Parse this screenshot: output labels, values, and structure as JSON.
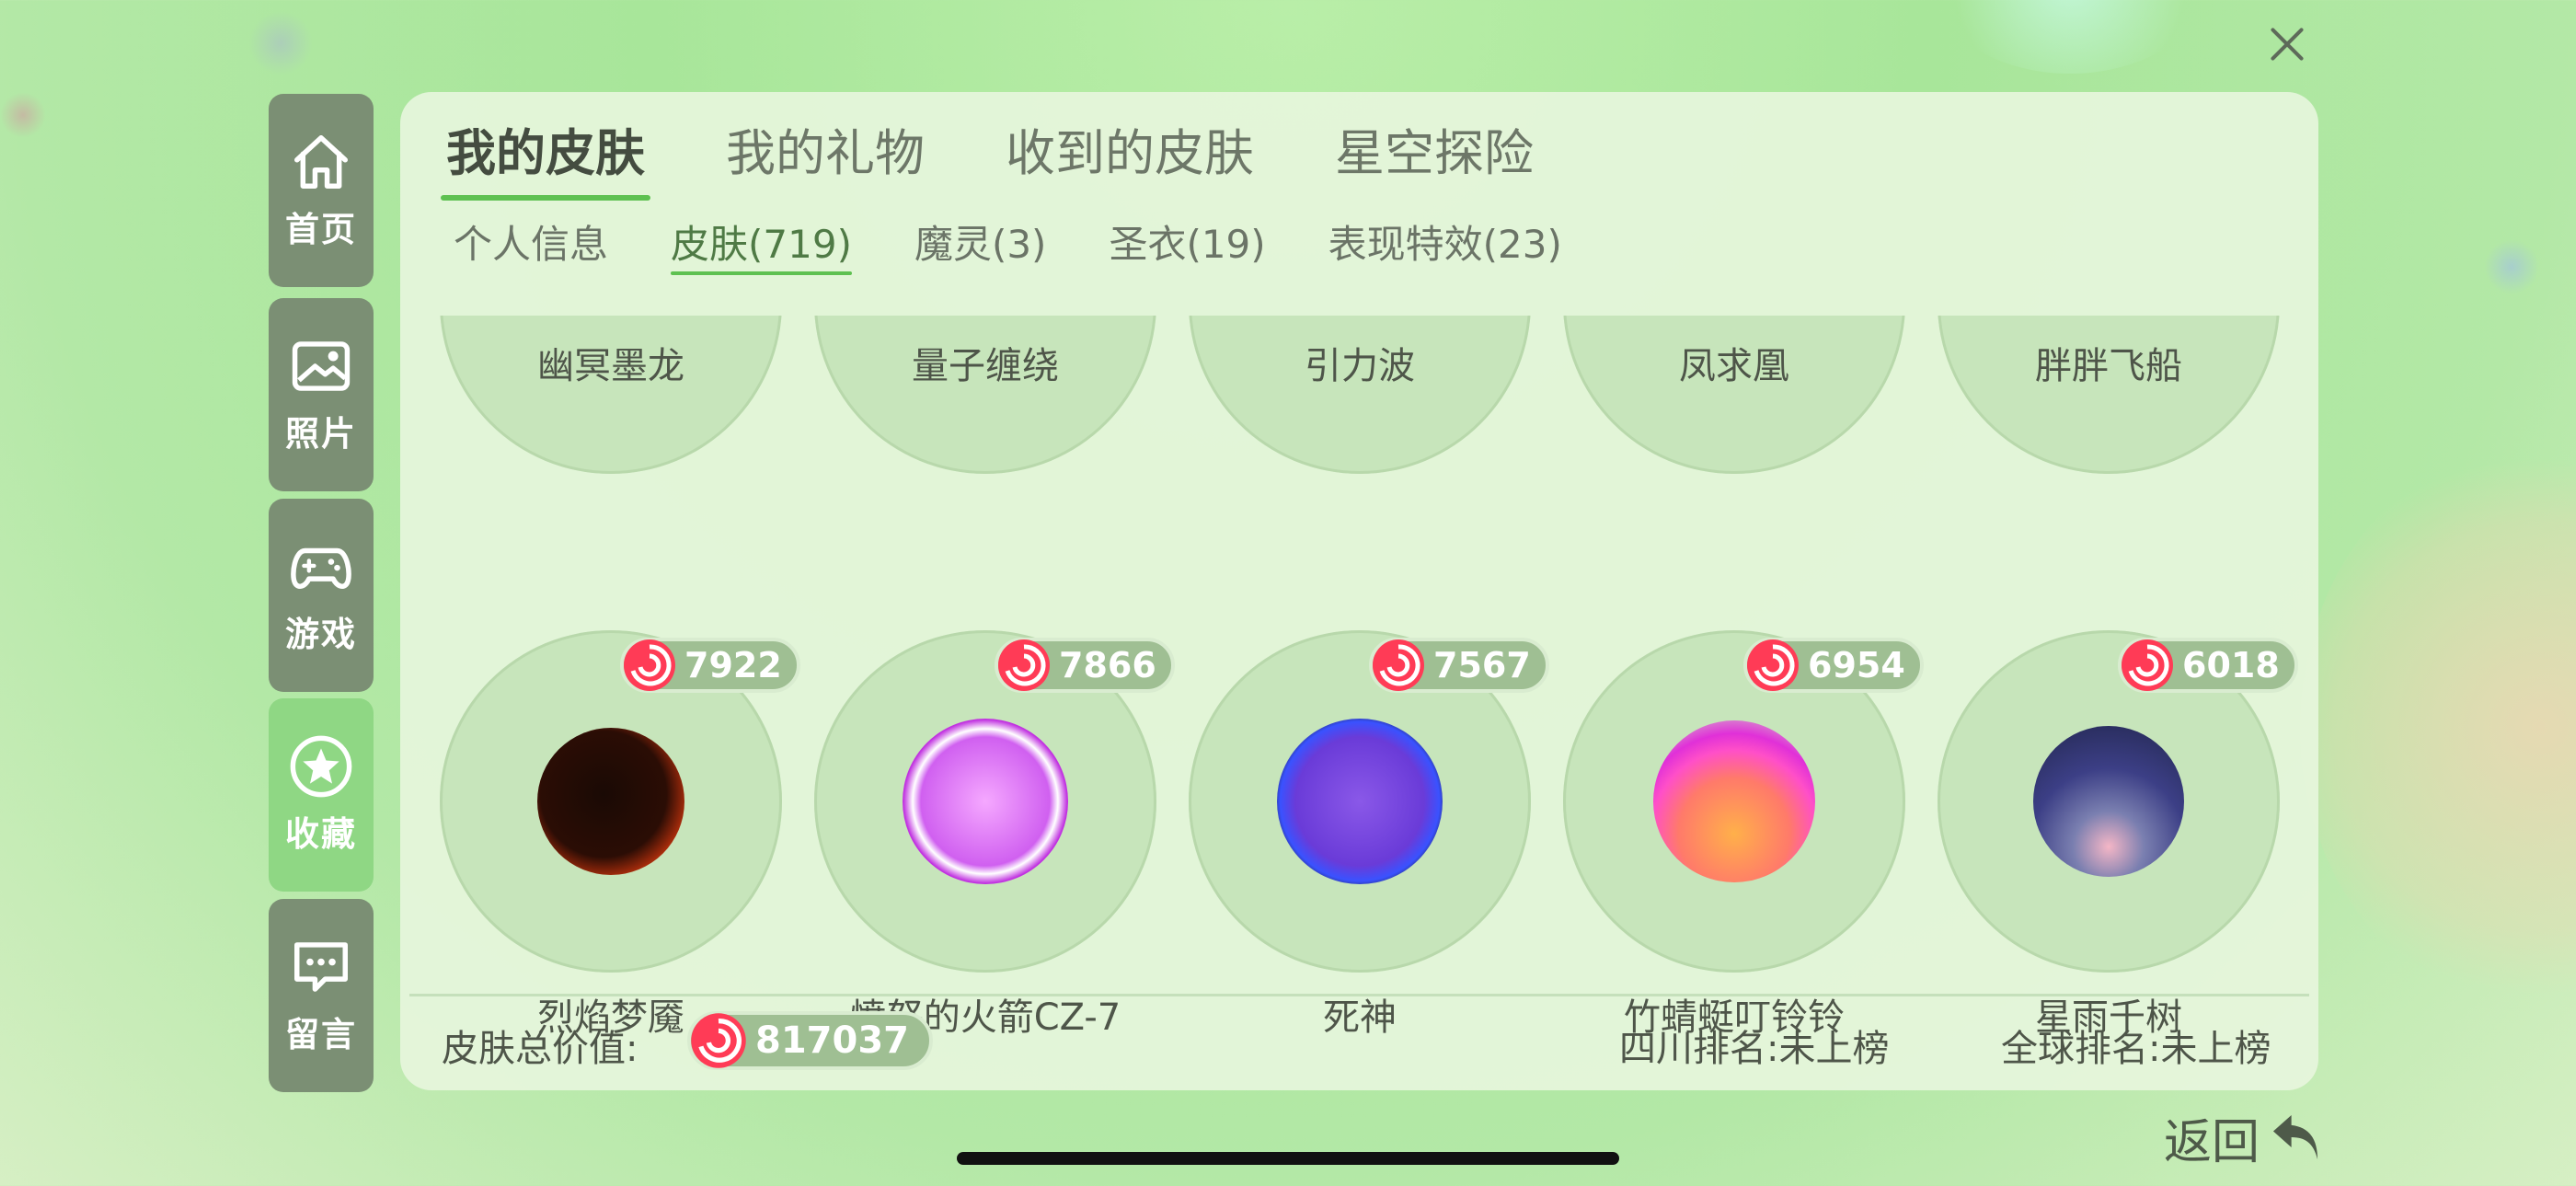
{
  "sidebar": {
    "items": [
      {
        "label": "首页",
        "icon": "home-icon",
        "active": false
      },
      {
        "label": "照片",
        "icon": "photo-icon",
        "active": false
      },
      {
        "label": "游戏",
        "icon": "gamepad-icon",
        "active": false
      },
      {
        "label": "收藏",
        "icon": "star-icon",
        "active": true
      },
      {
        "label": "留言",
        "icon": "message-icon",
        "active": false
      }
    ]
  },
  "tabs": [
    "我的皮肤",
    "我的礼物",
    "收到的皮肤",
    "星空探险"
  ],
  "subtabs": [
    "个人信息",
    "皮肤(719)",
    "魔灵(3)",
    "圣衣(19)",
    "表现特效(23)"
  ],
  "row1_names": [
    "幽冥墨龙",
    "量子缠绕",
    "引力波",
    "凤求凰",
    "胖胖飞船"
  ],
  "row2": [
    {
      "name": "烈焰梦魇",
      "price": "7922"
    },
    {
      "name": "愤怒的火箭CZ-7",
      "price": "7866"
    },
    {
      "name": "死神",
      "price": "7567"
    },
    {
      "name": "竹蜻蜓叮铃铃",
      "price": "6954"
    },
    {
      "name": "星雨千树",
      "price": "6018"
    }
  ],
  "footer": {
    "total_label": "皮肤总价值:",
    "total_value": "817037",
    "rank_region": "四川排名:未上榜",
    "rank_global": "全球排名:未上榜"
  },
  "back_label": "返回",
  "colors": {
    "accent": "#5ec151",
    "sidebar_active": "#8fd784",
    "sidebar": "#7b8f74"
  }
}
